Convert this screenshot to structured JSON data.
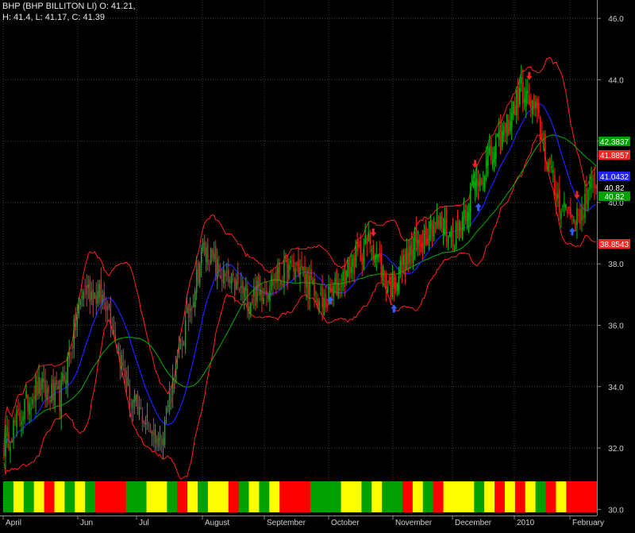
{
  "header": {
    "line1": "BHP (BHP BILLITON LI) O: 41.21,",
    "line2": "H: 41.4, L: 41.17, C: 41.39"
  },
  "chart_data": {
    "type": "candlestick",
    "title": "BHP (BHP BILLITON LI) O: 41.21, H: 41.4, L: 41.17, C: 41.39",
    "xlabel": "",
    "ylabel": "",
    "ylim": [
      29.8,
      46.6
    ],
    "y_ticks": [
      30.0,
      32.0,
      34.0,
      36.0,
      38.0,
      40.0,
      42.0,
      44.0,
      46.0
    ],
    "x_ticks": [
      "April",
      "Jun",
      "Jul",
      "August",
      "September",
      "October",
      "November",
      "December",
      "2010",
      "February"
    ],
    "grid": true,
    "last_values": {
      "upper_band": 41.8857,
      "green_ma": 42.3837,
      "blue_ma": 41.0432,
      "close_label_1": 40.82,
      "close_label_2": 40.82,
      "lower_band": 38.8543
    },
    "colors": {
      "up_candle": "#00c000",
      "down_candle": "#ff2020",
      "band": "#ff2020",
      "blue_ma": "#2020ff",
      "green_ma": "#00b000",
      "label_green": "#00a000",
      "label_red": "#ff2020",
      "label_blue": "#2020ff",
      "grid": "#3a3a3a",
      "ribbon_red": "#ff0000",
      "ribbon_yellow": "#ffff00",
      "ribbon_green": "#00a000"
    },
    "waypoints": [
      [
        0,
        32.1
      ],
      [
        20,
        34.0
      ],
      [
        35,
        33.6
      ],
      [
        50,
        37.2
      ],
      [
        65,
        36.8
      ],
      [
        80,
        33.5
      ],
      [
        98,
        32.3
      ],
      [
        110,
        35.0
      ],
      [
        125,
        38.5
      ],
      [
        140,
        37.4
      ],
      [
        155,
        36.9
      ],
      [
        170,
        37.5
      ],
      [
        185,
        37.9
      ],
      [
        200,
        36.6
      ],
      [
        215,
        37.7
      ],
      [
        230,
        38.8
      ],
      [
        242,
        37.2
      ],
      [
        255,
        38.3
      ],
      [
        270,
        39.4
      ],
      [
        283,
        38.9
      ],
      [
        296,
        40.6
      ],
      [
        312,
        42.0
      ],
      [
        325,
        43.7
      ],
      [
        335,
        42.8
      ],
      [
        347,
        40.2
      ],
      [
        360,
        39.4
      ],
      [
        372,
        40.8
      ]
    ],
    "ribbon": [
      "green",
      "yellow",
      "green",
      "yellow",
      "red",
      "yellow",
      "green",
      "yellow",
      "green",
      "red",
      "red",
      "red",
      "green",
      "green",
      "yellow",
      "yellow",
      "green",
      "red",
      "yellow",
      "green",
      "yellow",
      "yellow",
      "red",
      "green",
      "yellow",
      "green",
      "yellow",
      "red",
      "red",
      "red",
      "green",
      "green",
      "green",
      "yellow",
      "yellow",
      "green",
      "yellow",
      "green",
      "green",
      "red",
      "yellow",
      "green",
      "red",
      "yellow",
      "yellow",
      "yellow",
      "green",
      "yellow",
      "red",
      "yellow",
      "red",
      "yellow",
      "green",
      "red",
      "yellow",
      "red",
      "red",
      "red"
    ],
    "sell_arrow_idx": [
      232,
      296,
      330,
      360
    ],
    "buy_arrow_idx": [
      205,
      245,
      298,
      357
    ]
  }
}
